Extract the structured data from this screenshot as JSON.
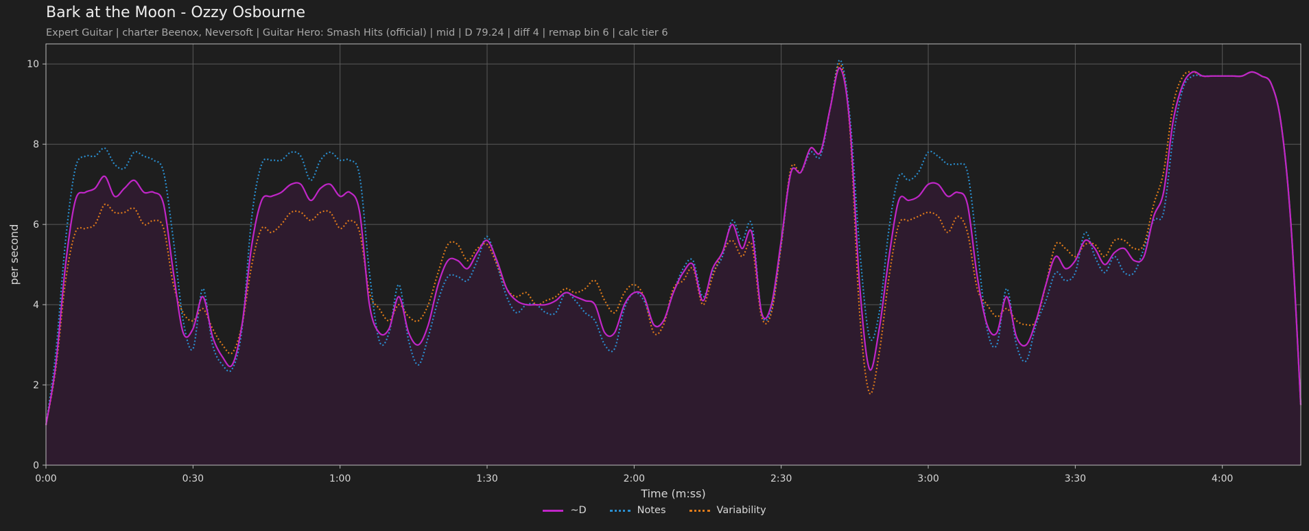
{
  "header": {
    "title": "Bark at the Moon - Ozzy Osbourne",
    "subtitle": "Expert Guitar  |  charter Beenox,  Neversoft  |  Guitar Hero: Smash Hits (official)  |  mid  |  D 79.24  |  diff 4  |  remap bin 6  |  calc tier 6"
  },
  "chart_data": {
    "type": "line",
    "title": "Bark at the Moon - Ozzy Osbourne",
    "xlabel": "Time (m:ss)",
    "ylabel": "per second",
    "xlim": [
      0,
      256
    ],
    "ylim": [
      0,
      10.5
    ],
    "grid": true,
    "legend_position": "bottom-center",
    "x_ticks": [
      0,
      30,
      60,
      90,
      120,
      150,
      180,
      210,
      240
    ],
    "x_tick_labels": [
      "0:00",
      "0:30",
      "1:00",
      "1:30",
      "2:00",
      "2:30",
      "3:00",
      "3:30",
      "4:00"
    ],
    "y_ticks": [
      0,
      2,
      4,
      6,
      8,
      10
    ],
    "y_tick_labels": [
      "0",
      "2",
      "4",
      "6",
      "8",
      "10"
    ],
    "x": [
      0,
      2,
      4,
      6,
      8,
      10,
      12,
      14,
      16,
      18,
      20,
      22,
      24,
      26,
      28,
      30,
      32,
      34,
      36,
      38,
      40,
      42,
      44,
      46,
      48,
      50,
      52,
      54,
      56,
      58,
      60,
      62,
      64,
      66,
      68,
      70,
      72,
      74,
      76,
      78,
      80,
      82,
      84,
      86,
      88,
      90,
      92,
      94,
      96,
      98,
      100,
      102,
      104,
      106,
      108,
      110,
      112,
      114,
      116,
      118,
      120,
      122,
      124,
      126,
      128,
      130,
      132,
      134,
      136,
      138,
      140,
      142,
      144,
      146,
      148,
      150,
      152,
      154,
      156,
      158,
      160,
      162,
      164,
      166,
      168,
      170,
      172,
      174,
      176,
      178,
      180,
      182,
      184,
      186,
      188,
      190,
      192,
      194,
      196,
      198,
      200,
      202,
      204,
      206,
      208,
      210,
      212,
      214,
      216,
      218,
      220,
      222,
      224,
      226,
      228,
      230,
      232,
      234,
      236,
      238,
      240,
      242,
      244,
      246,
      248,
      250,
      252,
      254,
      256
    ],
    "series": [
      {
        "name": "~D",
        "color": "#c026c7",
        "style": "solid",
        "fill": true,
        "values": [
          1.0,
          2.5,
          5.0,
          6.6,
          6.8,
          6.9,
          7.2,
          6.7,
          6.9,
          7.1,
          6.8,
          6.8,
          6.5,
          4.8,
          3.3,
          3.4,
          4.2,
          3.2,
          2.7,
          2.5,
          3.5,
          5.5,
          6.6,
          6.7,
          6.8,
          7.0,
          7.0,
          6.6,
          6.9,
          7.0,
          6.7,
          6.8,
          6.3,
          4.0,
          3.3,
          3.4,
          4.2,
          3.3,
          3.0,
          3.5,
          4.5,
          5.1,
          5.1,
          4.9,
          5.3,
          5.6,
          5.1,
          4.4,
          4.1,
          4.0,
          4.0,
          4.0,
          4.1,
          4.3,
          4.2,
          4.1,
          4.0,
          3.3,
          3.3,
          4.0,
          4.3,
          4.2,
          3.5,
          3.6,
          4.3,
          4.8,
          5.0,
          4.1,
          4.9,
          5.3,
          6.0,
          5.4,
          5.8,
          3.8,
          4.0,
          5.6,
          7.3,
          7.3,
          7.9,
          7.8,
          8.9,
          9.9,
          8.5,
          4.5,
          2.4,
          3.4,
          5.2,
          6.6,
          6.6,
          6.7,
          7.0,
          7.0,
          6.7,
          6.8,
          6.5,
          4.7,
          3.5,
          3.3,
          4.2,
          3.2,
          3.0,
          3.6,
          4.5,
          5.2,
          4.9,
          5.1,
          5.6,
          5.4,
          5.0,
          5.3,
          5.4,
          5.1,
          5.2,
          6.2,
          6.8,
          8.6,
          9.5,
          9.8,
          9.7,
          9.7,
          9.7,
          9.7,
          9.7,
          9.8,
          9.7,
          9.5,
          8.5,
          6.0,
          1.5
        ]
      },
      {
        "name": "Notes",
        "color": "#2a8fd0",
        "style": "dotted",
        "values": [
          1.0,
          2.8,
          5.6,
          7.4,
          7.7,
          7.7,
          7.9,
          7.5,
          7.4,
          7.8,
          7.7,
          7.6,
          7.3,
          5.6,
          3.6,
          2.9,
          4.4,
          3.0,
          2.5,
          2.4,
          3.4,
          6.2,
          7.5,
          7.6,
          7.6,
          7.8,
          7.7,
          7.1,
          7.6,
          7.8,
          7.6,
          7.6,
          7.2,
          4.8,
          3.1,
          3.3,
          4.5,
          3.1,
          2.5,
          3.2,
          4.1,
          4.7,
          4.7,
          4.6,
          5.1,
          5.7,
          5.0,
          4.2,
          3.8,
          4.0,
          4.0,
          3.8,
          3.8,
          4.3,
          4.1,
          3.8,
          3.6,
          3.0,
          2.9,
          3.9,
          4.3,
          4.1,
          3.5,
          3.6,
          4.3,
          4.9,
          5.1,
          4.2,
          4.8,
          5.2,
          6.1,
          5.6,
          6.0,
          3.8,
          3.9,
          5.5,
          7.3,
          7.3,
          7.8,
          7.7,
          8.9,
          10.1,
          8.7,
          5.4,
          3.2,
          3.8,
          5.9,
          7.2,
          7.1,
          7.3,
          7.8,
          7.7,
          7.5,
          7.5,
          7.3,
          5.4,
          3.4,
          3.0,
          4.4,
          3.0,
          2.6,
          3.5,
          4.1,
          4.8,
          4.6,
          4.8,
          5.8,
          5.2,
          4.8,
          5.2,
          4.8,
          4.8,
          5.4,
          6.1,
          6.3,
          8.2,
          9.4,
          9.7,
          9.7,
          9.7,
          9.7,
          9.7,
          9.7,
          9.8,
          9.7,
          9.5,
          8.5,
          6.0,
          1.5
        ]
      },
      {
        "name": "Variability",
        "color": "#e07b1a",
        "style": "dotted",
        "values": [
          1.0,
          2.4,
          4.6,
          5.8,
          5.9,
          6.0,
          6.5,
          6.3,
          6.3,
          6.4,
          6.0,
          6.1,
          5.9,
          4.5,
          3.8,
          3.6,
          3.9,
          3.4,
          3.0,
          2.8,
          3.5,
          5.0,
          5.9,
          5.8,
          6.0,
          6.3,
          6.3,
          6.1,
          6.3,
          6.3,
          5.9,
          6.1,
          5.8,
          4.3,
          3.9,
          3.6,
          4.0,
          3.7,
          3.6,
          4.0,
          4.8,
          5.5,
          5.5,
          5.1,
          5.4,
          5.5,
          5.0,
          4.4,
          4.2,
          4.3,
          4.0,
          4.1,
          4.2,
          4.4,
          4.3,
          4.4,
          4.6,
          4.1,
          3.8,
          4.3,
          4.5,
          4.2,
          3.3,
          3.5,
          4.4,
          4.6,
          4.9,
          4.0,
          4.7,
          5.3,
          5.6,
          5.2,
          5.5,
          3.7,
          3.8,
          5.5,
          7.4,
          7.3,
          7.9,
          7.8,
          8.9,
          10.0,
          8.4,
          3.8,
          1.8,
          2.8,
          4.7,
          6.0,
          6.1,
          6.2,
          6.3,
          6.2,
          5.8,
          6.2,
          5.8,
          4.4,
          4.0,
          3.7,
          3.9,
          3.6,
          3.5,
          3.6,
          4.5,
          5.5,
          5.4,
          5.2,
          5.5,
          5.5,
          5.2,
          5.6,
          5.6,
          5.4,
          5.5,
          6.5,
          7.3,
          9.0,
          9.7,
          9.8,
          9.7,
          9.7,
          9.7,
          9.7,
          9.7,
          9.8,
          9.7,
          9.5,
          8.5,
          6.0,
          1.5
        ]
      }
    ]
  }
}
